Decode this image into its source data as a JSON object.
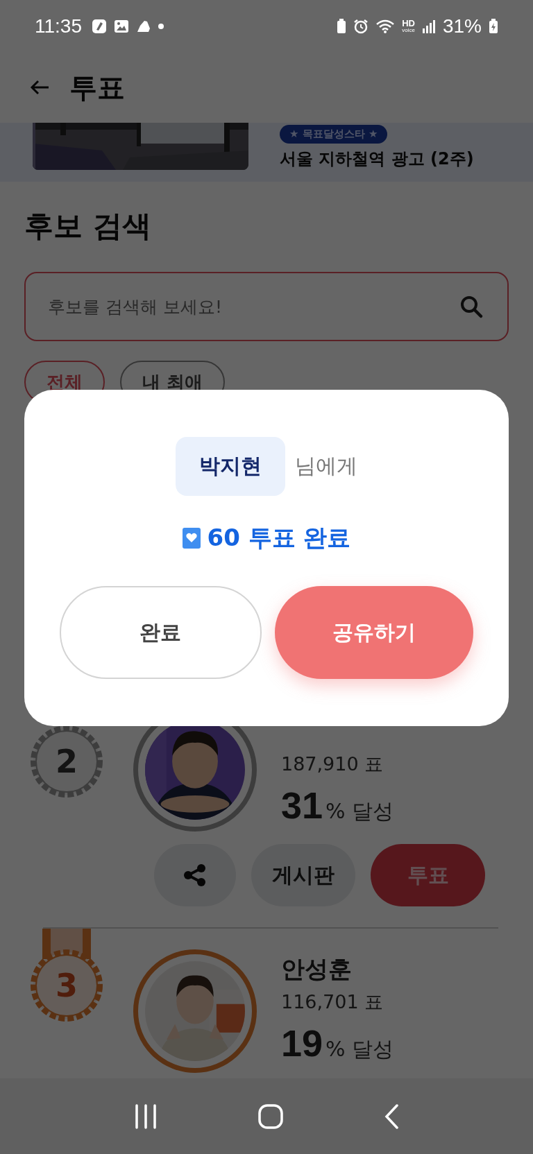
{
  "status_bar": {
    "time": "11:35",
    "hd_label": "HD",
    "hd_sublabel": "voice",
    "battery": "31%"
  },
  "header": {
    "title": "투표"
  },
  "banner": {
    "badge": "★ 목표달성스타 ★",
    "title": "서울 지하철역 광고 (2주)"
  },
  "search_section": {
    "title": "후보 검색",
    "search": {
      "placeholder": "후보를 검색해 보세요!"
    },
    "filters": [
      {
        "label": "전체",
        "selected": true
      },
      {
        "label": "내 최애",
        "selected": false
      }
    ]
  },
  "candidates": [
    {
      "rank": "2",
      "kind": "silver",
      "votes": "187,910 표",
      "percent": "31",
      "percent_suffix": "% 달성",
      "actions": {
        "board": "게시판",
        "vote": "투표"
      }
    },
    {
      "rank": "3",
      "kind": "bronze",
      "name": "안성훈",
      "votes": "116,701 표",
      "percent": "19",
      "percent_suffix": "% 달성"
    }
  ],
  "dialog": {
    "recipient": "박지현",
    "recipient_suffix": "님에게",
    "result": "60 투표 완료",
    "buttons": [
      {
        "label": "완료",
        "kind": "secondary"
      },
      {
        "label": "공유하기",
        "kind": "primary"
      }
    ]
  }
}
